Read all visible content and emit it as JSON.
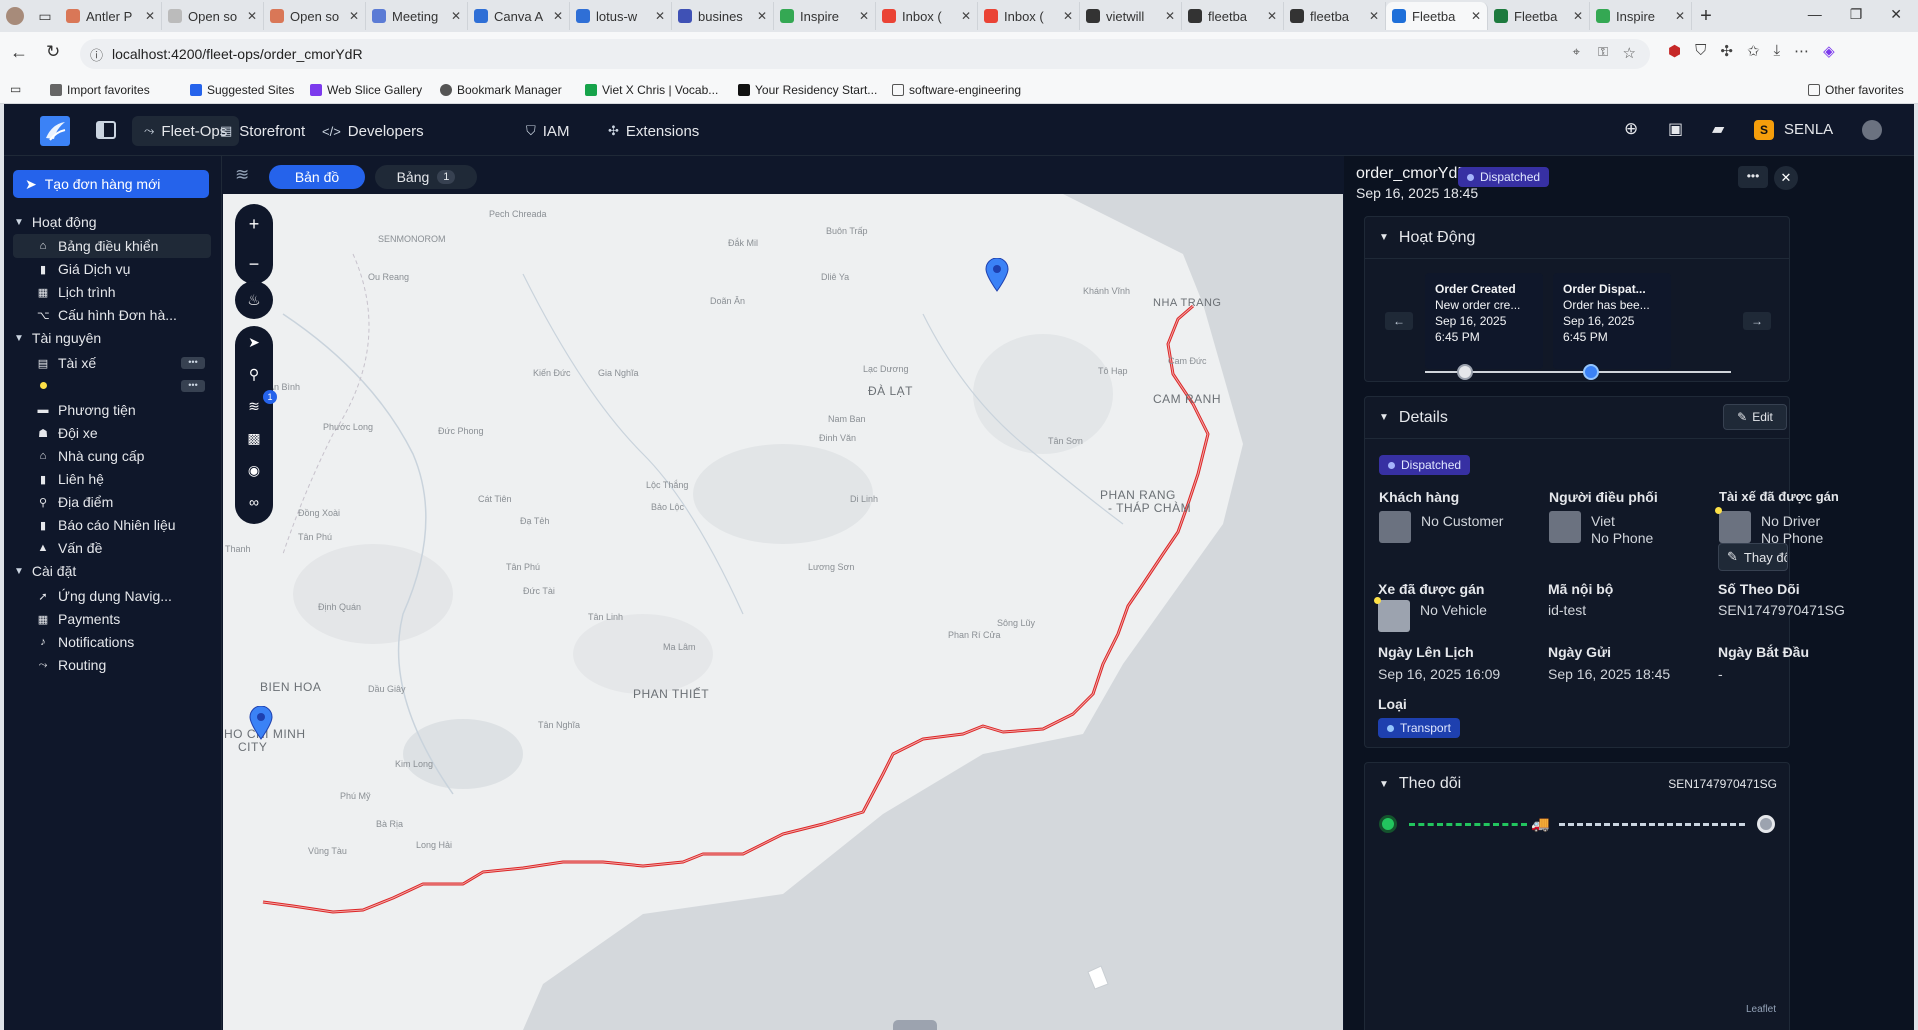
{
  "browser": {
    "tabs": [
      {
        "title": "Antler P",
        "color": "#d97757"
      },
      {
        "title": "Open so",
        "color": "#bbbbbb"
      },
      {
        "title": "Open so",
        "color": "#d97757"
      },
      {
        "title": "Meeting",
        "color": "#5b7bd5"
      },
      {
        "title": "Canva A",
        "color": "#2f6fd6"
      },
      {
        "title": "lotus-w",
        "color": "#2f6fd6"
      },
      {
        "title": "busines",
        "color": "#3f51b5"
      },
      {
        "title": "Inspire",
        "color": "#34a853"
      },
      {
        "title": "Inbox (",
        "color": "#ea4335"
      },
      {
        "title": "Inbox (",
        "color": "#ea4335"
      },
      {
        "title": "vietwill",
        "color": "#333333"
      },
      {
        "title": "fleetba",
        "color": "#333333"
      },
      {
        "title": "fleetba",
        "color": "#333333"
      },
      {
        "title": "Fleetba",
        "color": "#1e6fd9"
      },
      {
        "title": "Fleetba",
        "color": "#1d7a3e"
      },
      {
        "title": "Inspire",
        "color": "#34a853"
      }
    ],
    "url": "localhost:4200/fleet-ops/order_cmorYdR",
    "bookmarks": [
      "Import favorites",
      "Suggested Sites",
      "Web Slice Gallery",
      "Bookmark Manager",
      "Viet X Chris | Vocab...",
      "Your Residency Start...",
      "software-engineering"
    ],
    "other_favorites": "Other favorites"
  },
  "topnav": {
    "items": [
      {
        "label": "Fleet-Ops",
        "icon": "route-icon"
      },
      {
        "label": "Storefront",
        "icon": "store-icon"
      },
      {
        "label": "Developers",
        "icon": "code-icon"
      },
      {
        "label": "IAM",
        "icon": "shield-icon"
      },
      {
        "label": "Extensions",
        "icon": "puzzle-icon"
      }
    ],
    "org_initial": "S",
    "org_name": "SENLA"
  },
  "sidebar": {
    "new_order": "Tạo đơn hàng mới",
    "sections": [
      {
        "label": "Hoạt động",
        "items": [
          "Bảng điều khiển",
          "Giá Dịch vụ",
          "Lịch trình",
          "Cấu hình Đơn hà..."
        ]
      },
      {
        "label": "Tài nguyên",
        "items": [
          "Tài xế",
          "",
          "Phương tiện",
          "Đội xe",
          "Nhà cung cấp",
          "Liên hệ",
          "Địa điểm",
          "Báo cáo Nhiên liệu",
          "Vấn đề"
        ]
      },
      {
        "label": "Cài đặt",
        "items": [
          "Ứng dụng Navig...",
          "Payments",
          "Notifications",
          "Routing"
        ]
      }
    ]
  },
  "map": {
    "tab_map": "Bản đồ",
    "tab_table": "Bảng",
    "table_count": "1",
    "layers_badge": "1",
    "attribution": "Leaflet",
    "places": {
      "nha_trang": "NHA TRANG",
      "cam_ranh": "CAM RANH",
      "phan_rang": "PHAN RANG",
      "thap_cham": "- THÁP CHÀM",
      "da_lat": "ĐÀ LẠT",
      "bien_hoa": "BIEN HOA",
      "ho_chi_minh": "HO CHI MINH",
      "city": "CITY",
      "phan_thiet": "PHAN THIẾT",
      "senmonorom": "SENMONOROM",
      "pech_chreada": "Pech Chreada",
      "buon_trap": "Buôn Trấp",
      "dak_mil": "Đắk Mil",
      "ou_reang": "Ou Reang",
      "dlieya": "Dliê Ya",
      "khanh_vinh": "Khánh Vĩnh",
      "dong_an": "Doãn Ân",
      "cam_duc": "Cam Đức",
      "to_hap": "Tô Hạp",
      "lac_duong": "Lạc Dương",
      "kien_duc": "Kiến Đức",
      "gia_nghia": "Gia Nghĩa",
      "nam_ban": "Nam Ban",
      "dinh_van": "Đinh Văn",
      "tan_son": "Tân Sơn",
      "phuoc_long": "Phước Long",
      "duc_phong": "Đức Phong",
      "loc_thang": "Lộc Thắng",
      "bao_loc": "Bảo Lộc",
      "di_linh": "Di Linh",
      "cat_tien": "Cát Tiên",
      "da_teh": "Đạ Tẻh",
      "dong_xoai": "Đồng Xoài",
      "tan_phu_top": "Tân Phú",
      "an_binh": "An Bình",
      "thanh": "Thanh",
      "tan_phu": "Tân Phú",
      "duc_tai": "Đức Tài",
      "dinh_quan": "Định Quán",
      "luong_son": "Lương Sơn",
      "tan_linh": "Tân Linh",
      "ma_lam": "Ma Lâm",
      "phan_ri_cua": "Phan Rí Cửa",
      "song_luy": "Sông Lũy",
      "dau_giay": "Dầu Giây",
      "tan_nghia": "Tân Nghĩa",
      "kim_long": "Kim Long",
      "phu_my": "Phú Mỹ",
      "ba_ria": "Bà Rịa",
      "long_hai": "Long Hải",
      "vung_tau": "Vũng Tàu"
    }
  },
  "panel": {
    "order_id": "order_cmorYdR",
    "status": "Dispatched",
    "datetime": "Sep 16, 2025 18:45",
    "activity": {
      "title": "Hoạt Động",
      "events": [
        {
          "title": "Order Created",
          "desc": "New order cre...",
          "date": "Sep 16, 2025",
          "time": "6:45 PM"
        },
        {
          "title": "Order Dispat...",
          "desc": "Order has bee...",
          "date": "Sep 16, 2025",
          "time": "6:45 PM"
        }
      ]
    },
    "details": {
      "title": "Details",
      "edit": "Edit",
      "status": "Dispatched",
      "customer_label": "Khách hàng",
      "customer_value": "No Customer",
      "dispatcher_label": "Người điều phối",
      "dispatcher_name": "Viet",
      "dispatcher_phone": "No Phone",
      "driver_label": "Tài xế đã được gán",
      "driver_value": "No Driver",
      "driver_phone": "No Phone",
      "change_driver": "Thay đổi Tài Xế",
      "vehicle_label": "Xe đã được gán",
      "vehicle_value": "No Vehicle",
      "internal_label": "Mã nội bộ",
      "internal_value": "id-test",
      "tracking_label": "Số Theo Dõi",
      "tracking_value": "SEN1747970471SG",
      "scheduled_label": "Ngày Lên Lịch",
      "scheduled_value": "Sep 16, 2025 16:09",
      "sent_label": "Ngày Gửi",
      "sent_value": "Sep 16, 2025 18:45",
      "start_label": "Ngày Bắt Đầu",
      "start_value": "-",
      "type_label": "Loại",
      "type_value": "Transport"
    },
    "tracking": {
      "title": "Theo dõi",
      "number": "SEN1747970471SG"
    }
  },
  "colors": {
    "accent": "#2563eb",
    "route": "#dc2626",
    "pin": "#3b82f6",
    "dispatched_badge": "#3730a3",
    "tracking_green": "#22c55e"
  }
}
